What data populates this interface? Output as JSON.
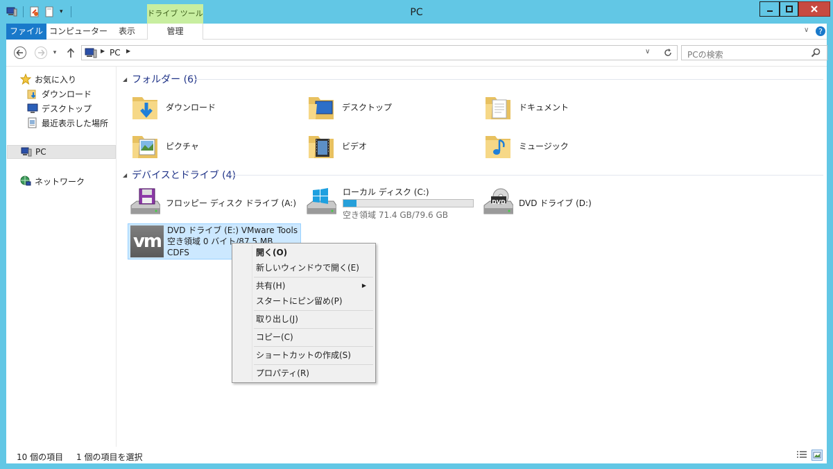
{
  "window": {
    "title": "PC"
  },
  "ribbon": {
    "contextual_tab": "ドライブ ツール",
    "tabs": [
      "ファイル",
      "コンピューター",
      "表示",
      "管理"
    ]
  },
  "address": {
    "path_root": "PC",
    "search_placeholder": "PCの検索"
  },
  "nav": {
    "favorites": "お気に入り",
    "downloads": "ダウンロード",
    "desktop": "デスクトップ",
    "recent": "最近表示した場所",
    "pc": "PC",
    "network": "ネットワーク"
  },
  "folders": {
    "header": "フォルダー (6)",
    "items": [
      "ダウンロード",
      "デスクトップ",
      "ドキュメント",
      "ピクチャ",
      "ビデオ",
      "ミュージック"
    ]
  },
  "devices": {
    "header": "デバイスとドライブ (4)",
    "floppy": "フロッピー ディスク ドライブ (A:)",
    "local_name": "ローカル ディスク (C:)",
    "local_free": "空き領域 71.4 GB/79.6 GB",
    "local_used_fraction": 0.1,
    "dvd_d": "DVD ドライブ (D:)",
    "dvd_e_name": "DVD ドライブ (E:) VMware Tools",
    "dvd_e_free": "空き領域 0 バイト/87.5 MB",
    "dvd_e_fs": "CDFS",
    "vm_logo": "vm",
    "dvd_logo": "DVD"
  },
  "context_menu": {
    "items": [
      "開く(O)",
      "新しいウィンドウで開く(E)",
      "共有(H)",
      "スタートにピン留め(P)",
      "取り出し(J)",
      "コピー(C)",
      "ショートカットの作成(S)",
      "プロパティ(R)"
    ]
  },
  "status": {
    "count": "10 個の項目",
    "selected": "1 個の項目を選択"
  },
  "colors": {
    "frame": "#62c7e5",
    "file_tab": "#1979ca",
    "contextual_tab": "#c8eea0",
    "selection": "#cce8ff",
    "header_text": "#1e3287",
    "bar_fill": "#26a0da"
  }
}
